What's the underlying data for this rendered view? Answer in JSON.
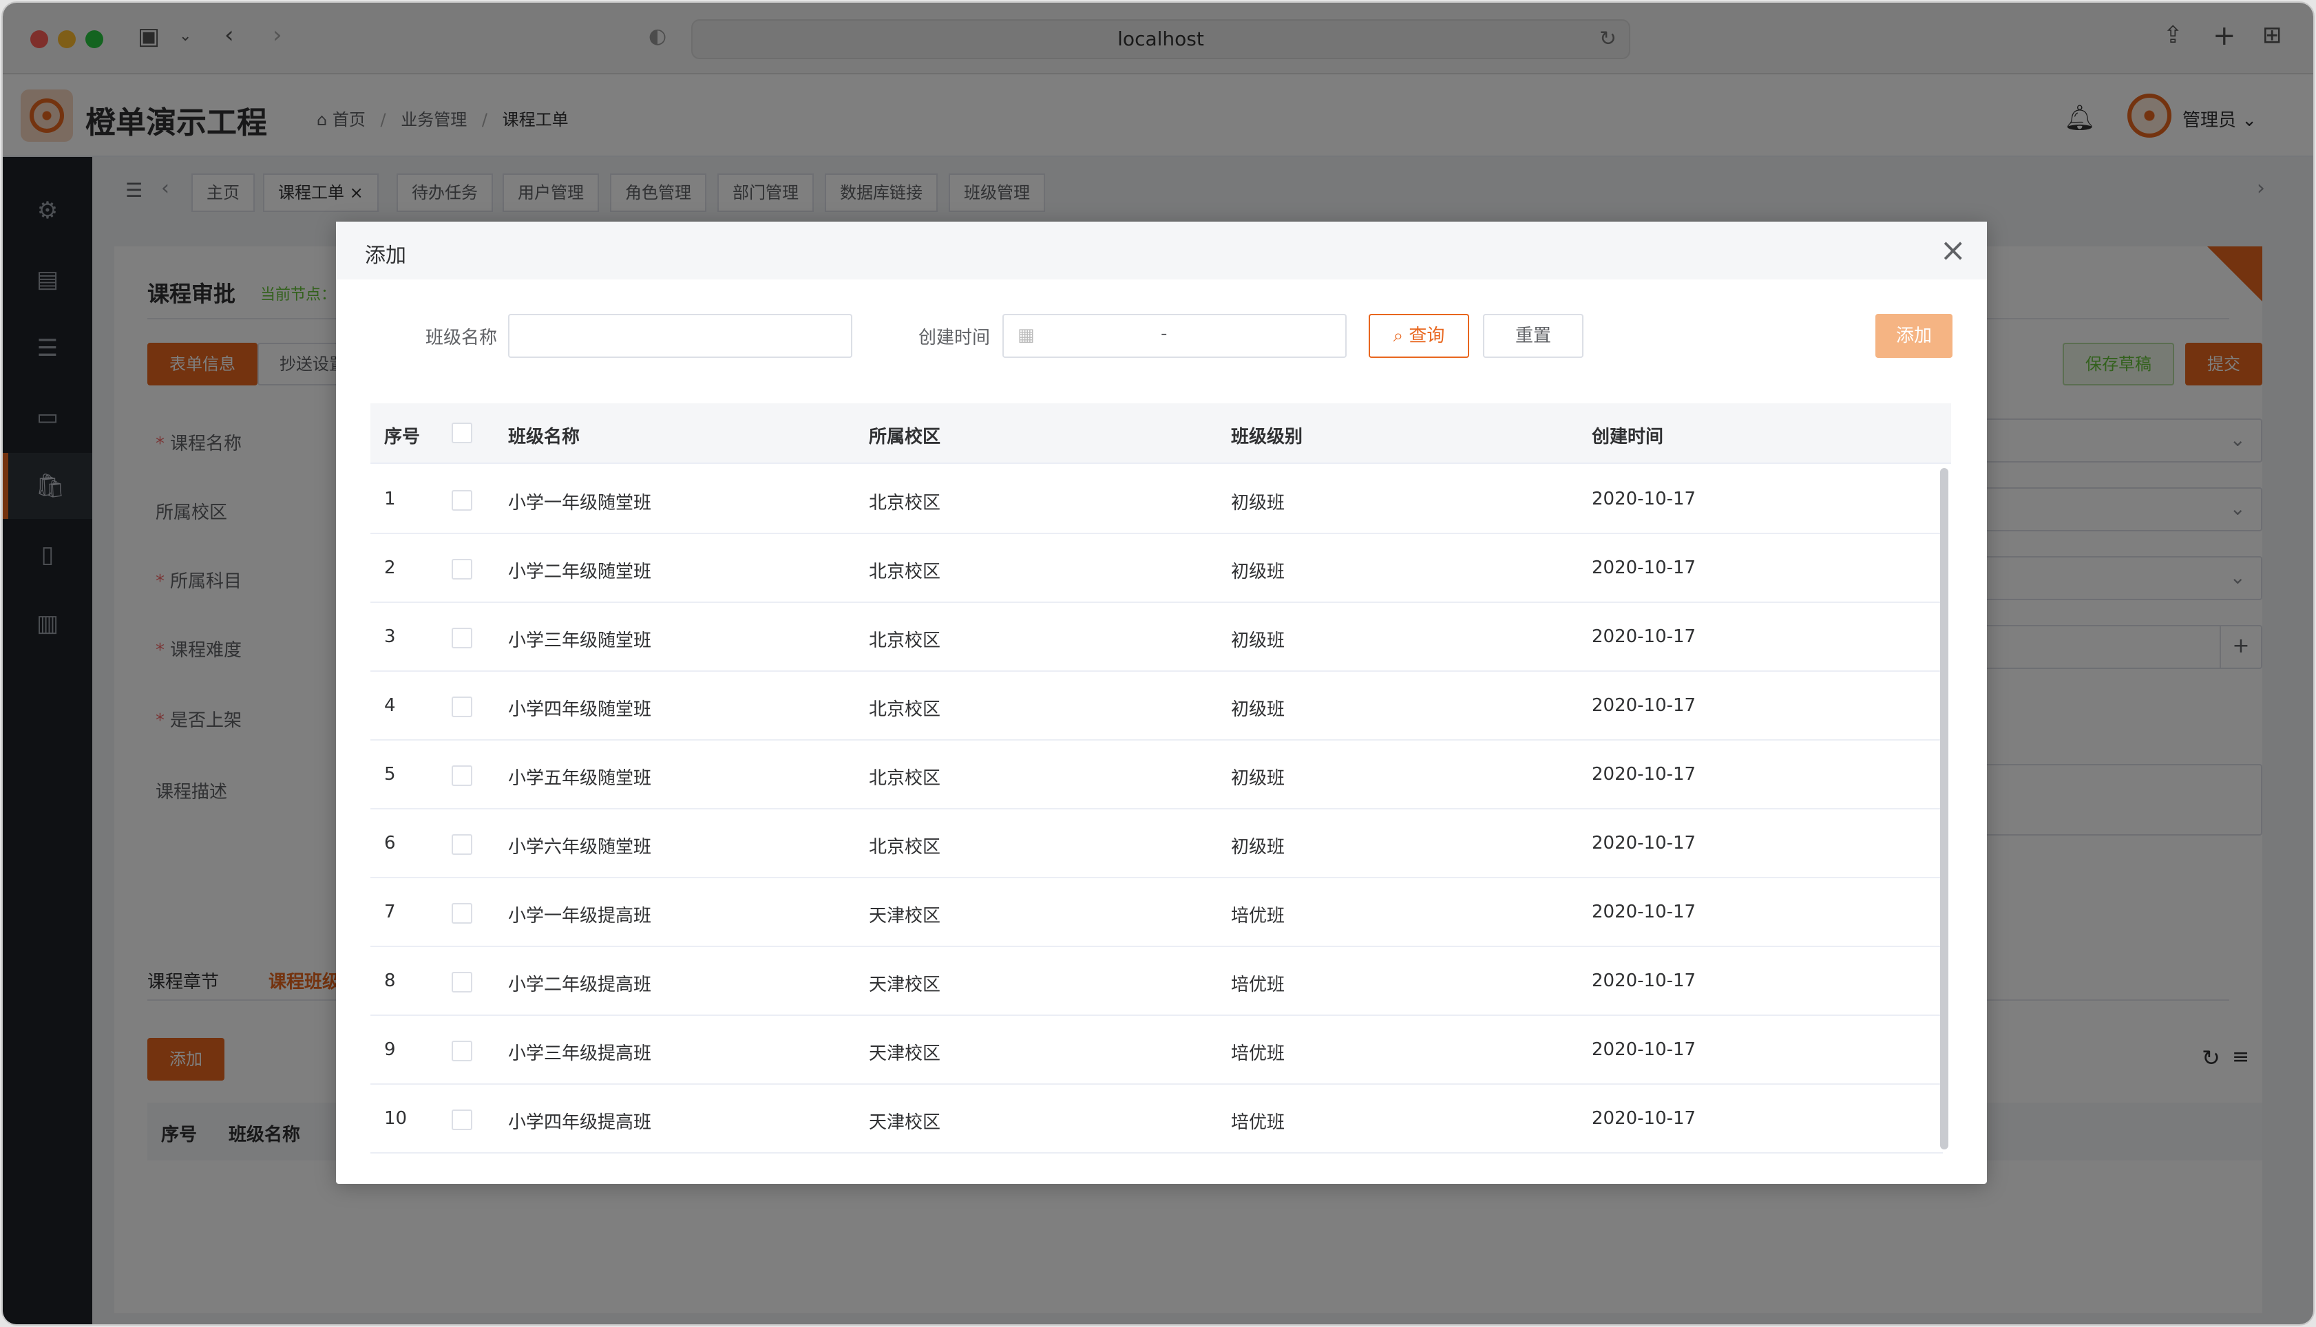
{
  "browser": {
    "url": "localhost"
  },
  "header": {
    "app_title": "橙单演示工程",
    "breadcrumb": [
      "首页",
      "业务管理",
      "课程工单"
    ],
    "user_name": "管理员"
  },
  "tabs": [
    {
      "label": "主页"
    },
    {
      "label": "课程工单"
    },
    {
      "label": "待办任务"
    },
    {
      "label": "用户管理"
    },
    {
      "label": "角色管理"
    },
    {
      "label": "部门管理"
    },
    {
      "label": "数据库链接"
    },
    {
      "label": "班级管理"
    }
  ],
  "page": {
    "title": "课程审批",
    "current_node": "当前节点：",
    "subtabs": [
      "表单信息",
      "抄送设置"
    ],
    "save_draft": "保存草稿",
    "submit": "提交",
    "fields": [
      {
        "label": "课程名称",
        "required": true
      },
      {
        "label": "所属校区",
        "required": false
      },
      {
        "label": "所属科目",
        "required": true
      },
      {
        "label": "课程难度",
        "required": true
      },
      {
        "label": "是否上架",
        "required": true
      },
      {
        "label": "课程描述",
        "required": false
      }
    ],
    "section_tabs": [
      "课程章节",
      "课程班级"
    ],
    "add_button": "添加",
    "inner_table_headers": [
      "序号",
      "班级名称"
    ]
  },
  "modal": {
    "title": "添加",
    "filters": {
      "class_name_label": "班级名称",
      "class_name_value": "",
      "created_time_label": "创建时间",
      "date_separator": "-"
    },
    "query_button": "查询",
    "reset_button": "重置",
    "add_button": "添加",
    "columns": [
      "序号",
      "班级名称",
      "所属校区",
      "班级级别",
      "创建时间"
    ],
    "rows": [
      {
        "no": "1",
        "name": "小学一年级随堂班",
        "campus": "北京校区",
        "level": "初级班",
        "created": "2020-10-17"
      },
      {
        "no": "2",
        "name": "小学二年级随堂班",
        "campus": "北京校区",
        "level": "初级班",
        "created": "2020-10-17"
      },
      {
        "no": "3",
        "name": "小学三年级随堂班",
        "campus": "北京校区",
        "level": "初级班",
        "created": "2020-10-17"
      },
      {
        "no": "4",
        "name": "小学四年级随堂班",
        "campus": "北京校区",
        "level": "初级班",
        "created": "2020-10-17"
      },
      {
        "no": "5",
        "name": "小学五年级随堂班",
        "campus": "北京校区",
        "level": "初级班",
        "created": "2020-10-17"
      },
      {
        "no": "6",
        "name": "小学六年级随堂班",
        "campus": "北京校区",
        "level": "初级班",
        "created": "2020-10-17"
      },
      {
        "no": "7",
        "name": "小学一年级提高班",
        "campus": "天津校区",
        "level": "培优班",
        "created": "2020-10-17"
      },
      {
        "no": "8",
        "name": "小学二年级提高班",
        "campus": "天津校区",
        "level": "培优班",
        "created": "2020-10-17"
      },
      {
        "no": "9",
        "name": "小学三年级提高班",
        "campus": "天津校区",
        "level": "培优班",
        "created": "2020-10-17"
      },
      {
        "no": "10",
        "name": "小学四年级提高班",
        "campus": "天津校区",
        "level": "培优班",
        "created": "2020-10-17"
      }
    ]
  },
  "colors": {
    "accent": "#e8661e",
    "sidebar": "#1f2329",
    "success": "#67c23a"
  }
}
